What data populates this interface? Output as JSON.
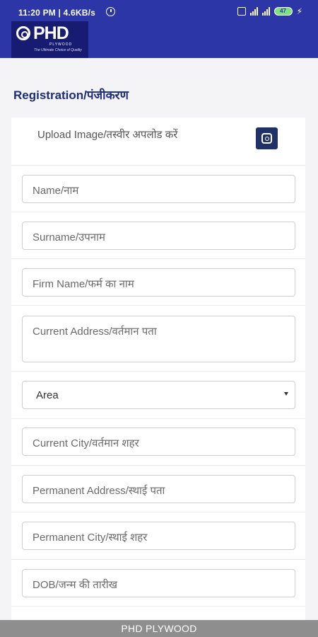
{
  "status_bar": {
    "time_speed": "11:20 PM | 4.6KB/s",
    "battery": "47"
  },
  "brand": {
    "logo_text": "PHD",
    "logo_sub": "PLYWOOD",
    "logo_tagline": "The Ultimate Choice of Quality"
  },
  "page": {
    "title": "Registration/पंजीकरण"
  },
  "form": {
    "upload_label": "Upload Image/तस्वीर अपलोड करें",
    "name": "Name/नाम",
    "surname": "Surname/उपनाम",
    "firm_name": "Firm Name/फर्म का नाम",
    "current_address": "Current Address/वर्तमान पता",
    "area": "Area",
    "current_city": "Current City/वर्तमान शहर",
    "permanent_address": "Permanent Address/स्थाई पता",
    "permanent_city": "Permanent City/स्थाई शहर",
    "dob": "DOB/जन्म की तारीख"
  },
  "footer": {
    "label": "PHD PLYWOOD"
  },
  "colors": {
    "header": "#2d36a6",
    "title": "#1d2d7a",
    "upload_button": "#1f3166",
    "footer": "#8e8e8e"
  }
}
